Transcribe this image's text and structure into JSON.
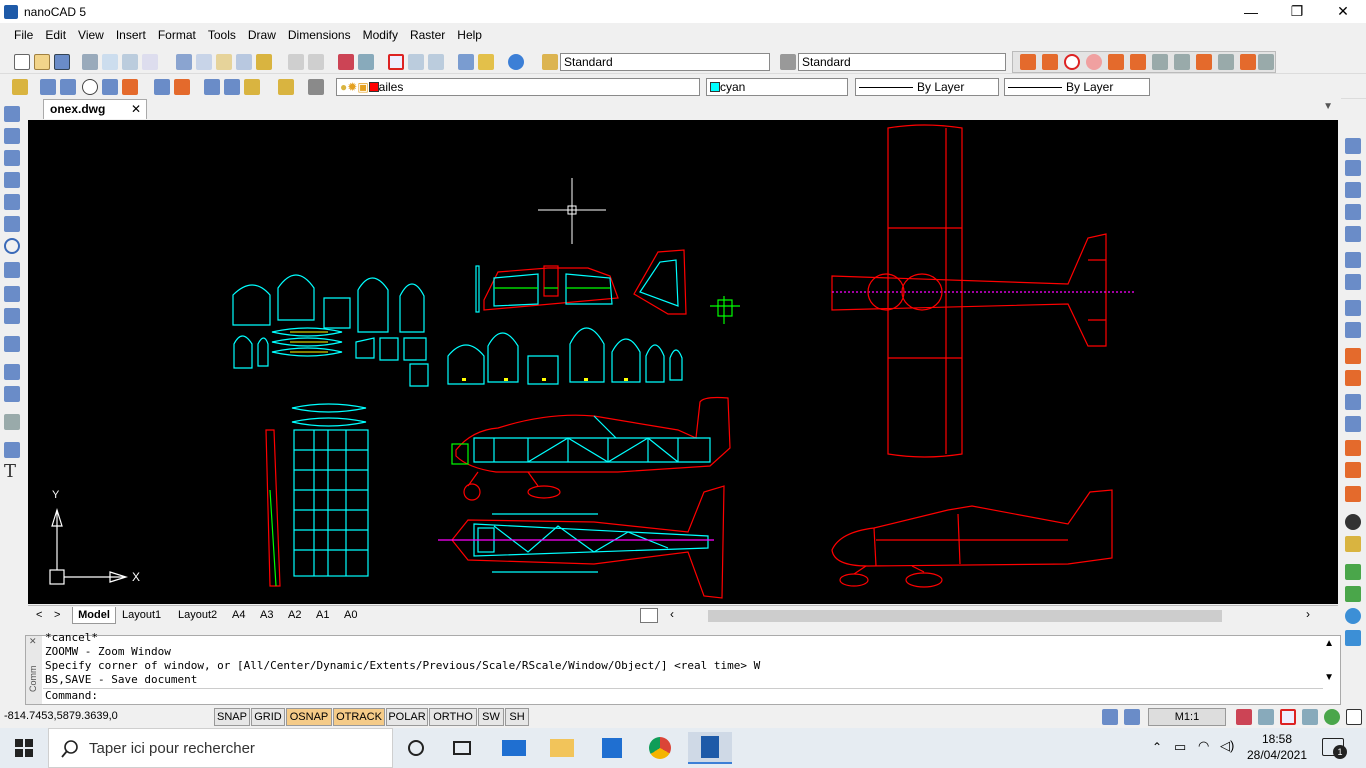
{
  "title_bar": {
    "app_title": "nanoCAD 5",
    "minimize": "—",
    "maximize": "❐",
    "close": "✕"
  },
  "menu": [
    "File",
    "Edit",
    "View",
    "Insert",
    "Format",
    "Tools",
    "Draw",
    "Dimensions",
    "Modify",
    "Raster",
    "Help"
  ],
  "toolbar": {
    "text_style": "Standard",
    "dim_style": "Standard",
    "layer": "ailes",
    "layer_color": "#ff0000",
    "color": "cyan",
    "color_swatch": "#00ffff",
    "linetype": "By Layer",
    "lineweight": "By Layer"
  },
  "document": {
    "tab_label": "onex.dwg",
    "tab_close": "✕"
  },
  "drawing": {
    "ucs_x_label": "X",
    "ucs_y_label": "Y"
  },
  "layout_tabs": [
    "Model",
    "Layout1",
    "Layout2",
    "A4",
    "A3",
    "A2",
    "A1",
    "A0"
  ],
  "layout_nav": {
    "prev": "<",
    "next": ">"
  },
  "command_panel": {
    "lines": [
      "*cancel*",
      "ZOOMW - Zoom Window",
      "Specify corner of window, or [All/Center/Dynamic/Extents/Previous/Scale/RScale/Window/Object/] <real time> W",
      "BS,SAVE - Save document"
    ],
    "prompt": "Command:",
    "grip_label": "Comm"
  },
  "status_bar": {
    "coordinates": "-814.7453,5879.3639,0",
    "buttons": [
      {
        "label": "SNAP",
        "on": false
      },
      {
        "label": "GRID",
        "on": false
      },
      {
        "label": "OSNAP",
        "on": true
      },
      {
        "label": "OTRACK",
        "on": true
      },
      {
        "label": "POLAR",
        "on": false
      },
      {
        "label": "ORTHO",
        "on": false
      },
      {
        "label": "SW",
        "on": false
      },
      {
        "label": "SH",
        "on": false
      }
    ],
    "scale": "M1:1"
  },
  "taskbar": {
    "search_placeholder": "Taper ici pour rechercher",
    "time": "18:58",
    "date": "28/04/2021",
    "notification_count": "1"
  }
}
